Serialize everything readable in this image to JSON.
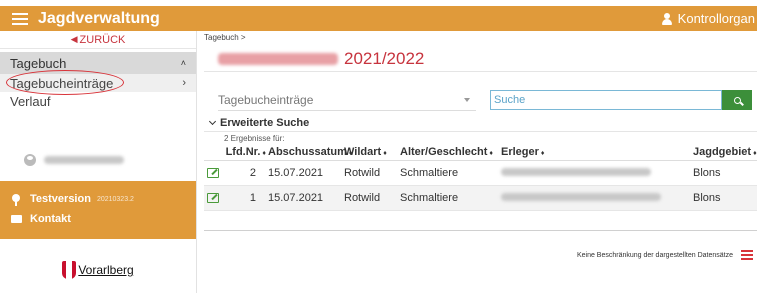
{
  "header": {
    "app_title": "Jagdverwaltung",
    "user_label": "Kontrollorgan"
  },
  "sidebar": {
    "back_label": "ZURÜCK",
    "group_label": "Tagebuch",
    "items": [
      {
        "label": "Tagebucheinträge"
      },
      {
        "label": "Verlauf"
      }
    ],
    "info": {
      "testversion_label": "Testversion",
      "version": "20210323.2",
      "kontakt_label": "Kontakt"
    },
    "logo_text": "Vorarlberg"
  },
  "main": {
    "breadcrumb": "Tagebuch >",
    "title_year": "2021/2022",
    "select_value": "Tagebucheinträge",
    "search_placeholder": "Suche",
    "advanced_search_label": "Erweiterte Suche",
    "results_label": "2 Ergebnisse für:",
    "table": {
      "headers": [
        "Lfd.Nr.",
        "Abschussatum",
        "Wildart",
        "Alter/Geschlecht",
        "Erleger",
        "Jagdgebiet"
      ],
      "rows": [
        {
          "lfd": "2",
          "date": "15.07.2021",
          "wildart": "Rotwild",
          "alter": "Schmaltiere",
          "jagdgebiet": "Blons"
        },
        {
          "lfd": "1",
          "date": "15.07.2021",
          "wildart": "Rotwild",
          "alter": "Schmaltiere",
          "jagdgebiet": "Blons"
        }
      ]
    },
    "footer_note": "Keine Beschränkung der dargestellten Datensätze"
  },
  "colors": {
    "header_bg": "#e09a3a",
    "accent_red": "#c7343e",
    "search_button": "#3c8f3a"
  }
}
